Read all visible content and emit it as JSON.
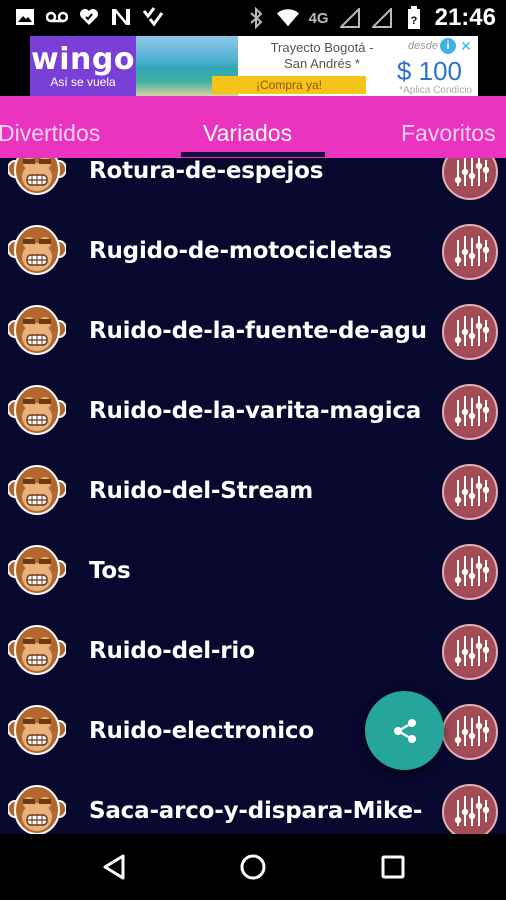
{
  "status_bar": {
    "time": "21:46",
    "network": "4G",
    "left_icons": [
      "gallery-icon",
      "voicemail-icon",
      "heart-icon",
      "n-icon",
      "checklist-icon"
    ],
    "right_icons": [
      "bluetooth-icon",
      "wifi-icon",
      "signal-icon",
      "signal-icon",
      "battery-icon"
    ]
  },
  "ad": {
    "brand": "wingo",
    "tagline": "Así se vuela",
    "headline_1": "Trayecto Bogotá -",
    "headline_2": "San Andrés *",
    "cta": "¡Compra ya!",
    "from_label": "desde",
    "price": "$ 100",
    "footnote": "*Aplica Condicio"
  },
  "tabs": [
    {
      "label": "Divertidos",
      "active": false
    },
    {
      "label": "Variados",
      "active": true
    },
    {
      "label": "Favoritos",
      "active": false
    }
  ],
  "sounds": [
    {
      "label": "Rotura-de-espejos"
    },
    {
      "label": "Rugido-de-motocicletas"
    },
    {
      "label": "Ruido-de-la-fuente-de-agu"
    },
    {
      "label": "Ruido-de-la-varita-magica"
    },
    {
      "label": "Ruido-del-Stream"
    },
    {
      "label": "Tos"
    },
    {
      "label": "Ruido-del-rio"
    },
    {
      "label": "Ruido-electronico"
    },
    {
      "label": "Saca-arco-y-dispara-Mike-"
    }
  ],
  "colors": {
    "tab_bar": "#ea34c0",
    "list_background": "#08082e",
    "fab": "#26a69a",
    "equalizer_button": "#a24c57",
    "monkey_fur": "#b5662c"
  },
  "fab": {
    "icon": "share-icon"
  },
  "nav": {
    "icons": [
      "back-icon",
      "home-icon",
      "recents-icon"
    ]
  }
}
